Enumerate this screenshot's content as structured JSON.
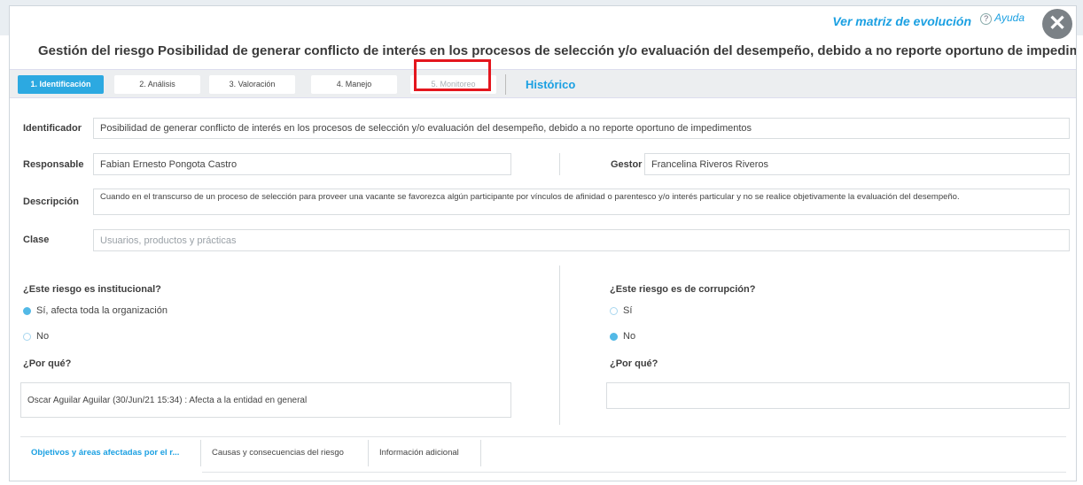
{
  "header": {
    "matrix_link": "Ver matriz de evolución",
    "help_label": "Ayuda",
    "help_icon": "?",
    "close_icon": "✕",
    "title": "Gestión del riesgo Posibilidad de generar conflicto de interés en los procesos de selección y/o evaluación del desempeño, debido a no reporte oportuno de impedimentos"
  },
  "steps": [
    {
      "label": "1. Identificación",
      "state": "active"
    },
    {
      "label": "2. Análisis",
      "state": "normal"
    },
    {
      "label": "3. Valoración",
      "state": "normal"
    },
    {
      "label": "4. Manejo",
      "state": "normal"
    },
    {
      "label": "5. Monitoreo",
      "state": "disabled"
    }
  ],
  "historico": "Histórico",
  "form": {
    "identificador_label": "Identificador",
    "identificador_value": "Posibilidad de generar conflicto de interés en los procesos de selección y/o evaluación del desempeño, debido a no reporte oportuno de impedimentos",
    "responsable_label": "Responsable",
    "responsable_value": "Fabian Ernesto Pongota Castro",
    "gestor_label": "Gestor",
    "gestor_value": "Francelina Riveros Riveros",
    "descripcion_label": "Descripción",
    "descripcion_value": "Cuando en el transcurso de un proceso de selección para proveer una vacante se favorezca algún participante por vínculos de afinidad o parentesco y/o interés particular y no se realice objetivamente la evaluación del desempeño.",
    "clase_label": "Clase",
    "clase_placeholder": "Usuarios, productos y prácticas"
  },
  "institucional": {
    "question": "¿Este riesgo es institucional?",
    "options": [
      {
        "label": "Sí, afecta toda la organización",
        "selected": true
      },
      {
        "label": "No",
        "selected": false
      }
    ],
    "why_label": "¿Por qué?",
    "why_value": "Oscar Aguilar Aguilar (30/Jun/21 15:34) : Afecta a la entidad en general"
  },
  "corrupcion": {
    "question": "¿Este riesgo es de corrupción?",
    "options": [
      {
        "label": "Sí",
        "selected": false
      },
      {
        "label": "No",
        "selected": true
      }
    ],
    "why_label": "¿Por qué?",
    "why_value": ""
  },
  "bottom_tabs": [
    {
      "label": "Objetivos y áreas afectadas por el r...",
      "active": true
    },
    {
      "label": "Causas y consecuencias del riesgo",
      "active": false
    },
    {
      "label": "Información adicional",
      "active": false
    }
  ],
  "colors": {
    "accent": "#1ba0e2",
    "active_step": "#2ca9e1",
    "highlight": "#e4161e",
    "close_button": "#7b8186"
  }
}
